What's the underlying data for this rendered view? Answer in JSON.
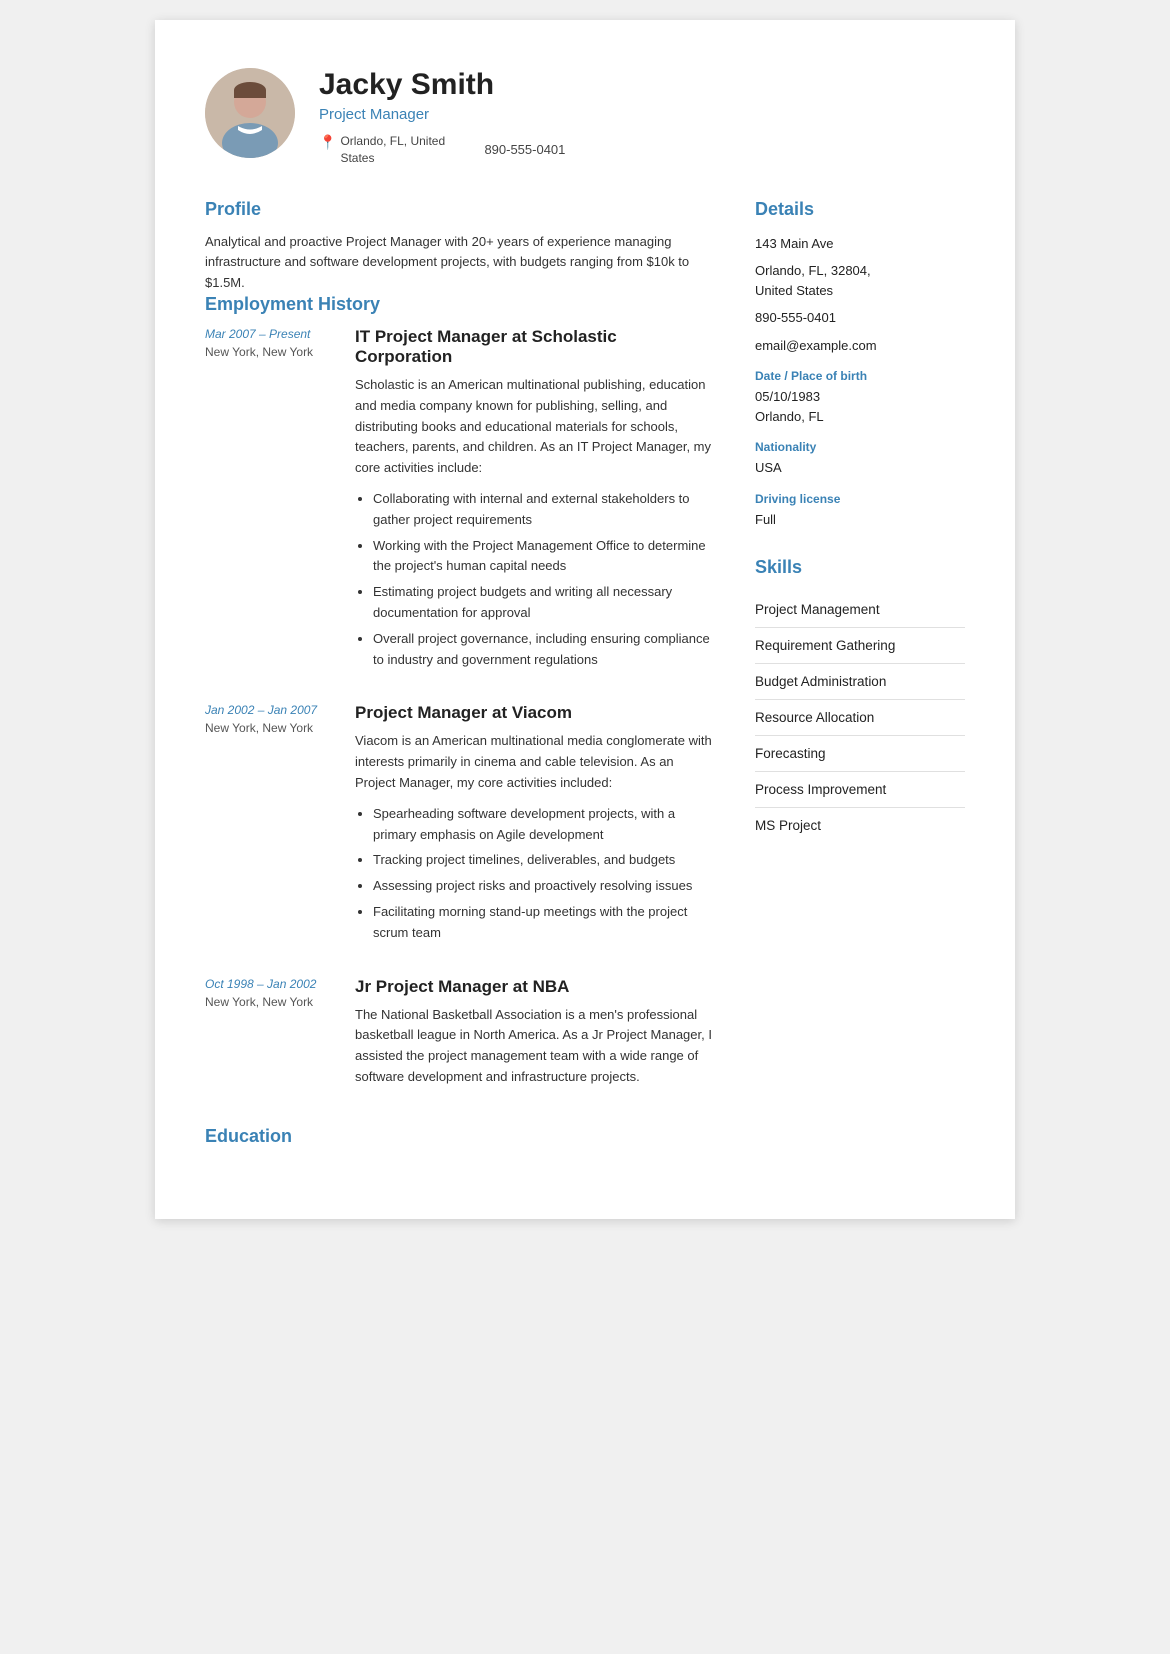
{
  "header": {
    "name": "Jacky Smith",
    "job_title": "Project Manager",
    "location": "Orlando, FL, United States",
    "phone": "890-555-0401"
  },
  "profile": {
    "section_title": "Profile",
    "text": "Analytical and proactive Project Manager with 20+ years of experience managing infrastructure and software development projects, with budgets ranging from $10k to $1.5M."
  },
  "employment": {
    "section_title": "Employment History",
    "jobs": [
      {
        "date": "Mar 2007 – Present",
        "location": "New York, New York",
        "title": "IT Project Manager at Scholastic Corporation",
        "description": "Scholastic is an American multinational publishing, education and media company known for publishing, selling, and distributing books and educational materials for schools, teachers, parents, and children. As an IT Project Manager, my core activities include:",
        "bullets": [
          "Collaborating with internal and external stakeholders to gather project requirements",
          "Working with the Project Management Office to determine the project's human capital needs",
          "Estimating project budgets and writing all necessary documentation for approval",
          "Overall project governance, including ensuring compliance to industry and government regulations"
        ]
      },
      {
        "date": "Jan 2002 – Jan 2007",
        "location": "New York, New York",
        "title": "Project Manager at Viacom",
        "description": "Viacom is an American multinational media conglomerate with interests primarily in cinema and cable television. As an Project Manager, my core activities included:",
        "bullets": [
          "Spearheading software development projects, with a primary emphasis on Agile development",
          "Tracking project timelines, deliverables, and budgets",
          "Assessing project risks and proactively resolving issues",
          "Facilitating morning stand-up meetings with the project scrum team"
        ]
      },
      {
        "date": "Oct 1998 – Jan 2002",
        "location": "New York, New York",
        "title": "Jr Project Manager at NBA",
        "description": "The National Basketball Association is a men's professional basketball league in North America. As a Jr Project Manager, I assisted the project management team with a wide range of software development and infrastructure projects.",
        "bullets": []
      }
    ]
  },
  "education": {
    "section_title": "Education"
  },
  "details": {
    "section_title": "Details",
    "address1": "143 Main Ave",
    "address2": "Orlando, FL, 32804,",
    "address3": "United States",
    "phone": "890-555-0401",
    "email": "email@example.com",
    "dob_label": "Date / Place of birth",
    "dob": "05/10/1983",
    "dob_place": "Orlando, FL",
    "nationality_label": "Nationality",
    "nationality": "USA",
    "license_label": "Driving license",
    "license": "Full"
  },
  "skills": {
    "section_title": "Skills",
    "items": [
      "Project Management",
      "Requirement Gathering",
      "Budget Administration",
      "Resource Allocation",
      "Forecasting",
      "Process Improvement",
      "MS Project"
    ]
  }
}
